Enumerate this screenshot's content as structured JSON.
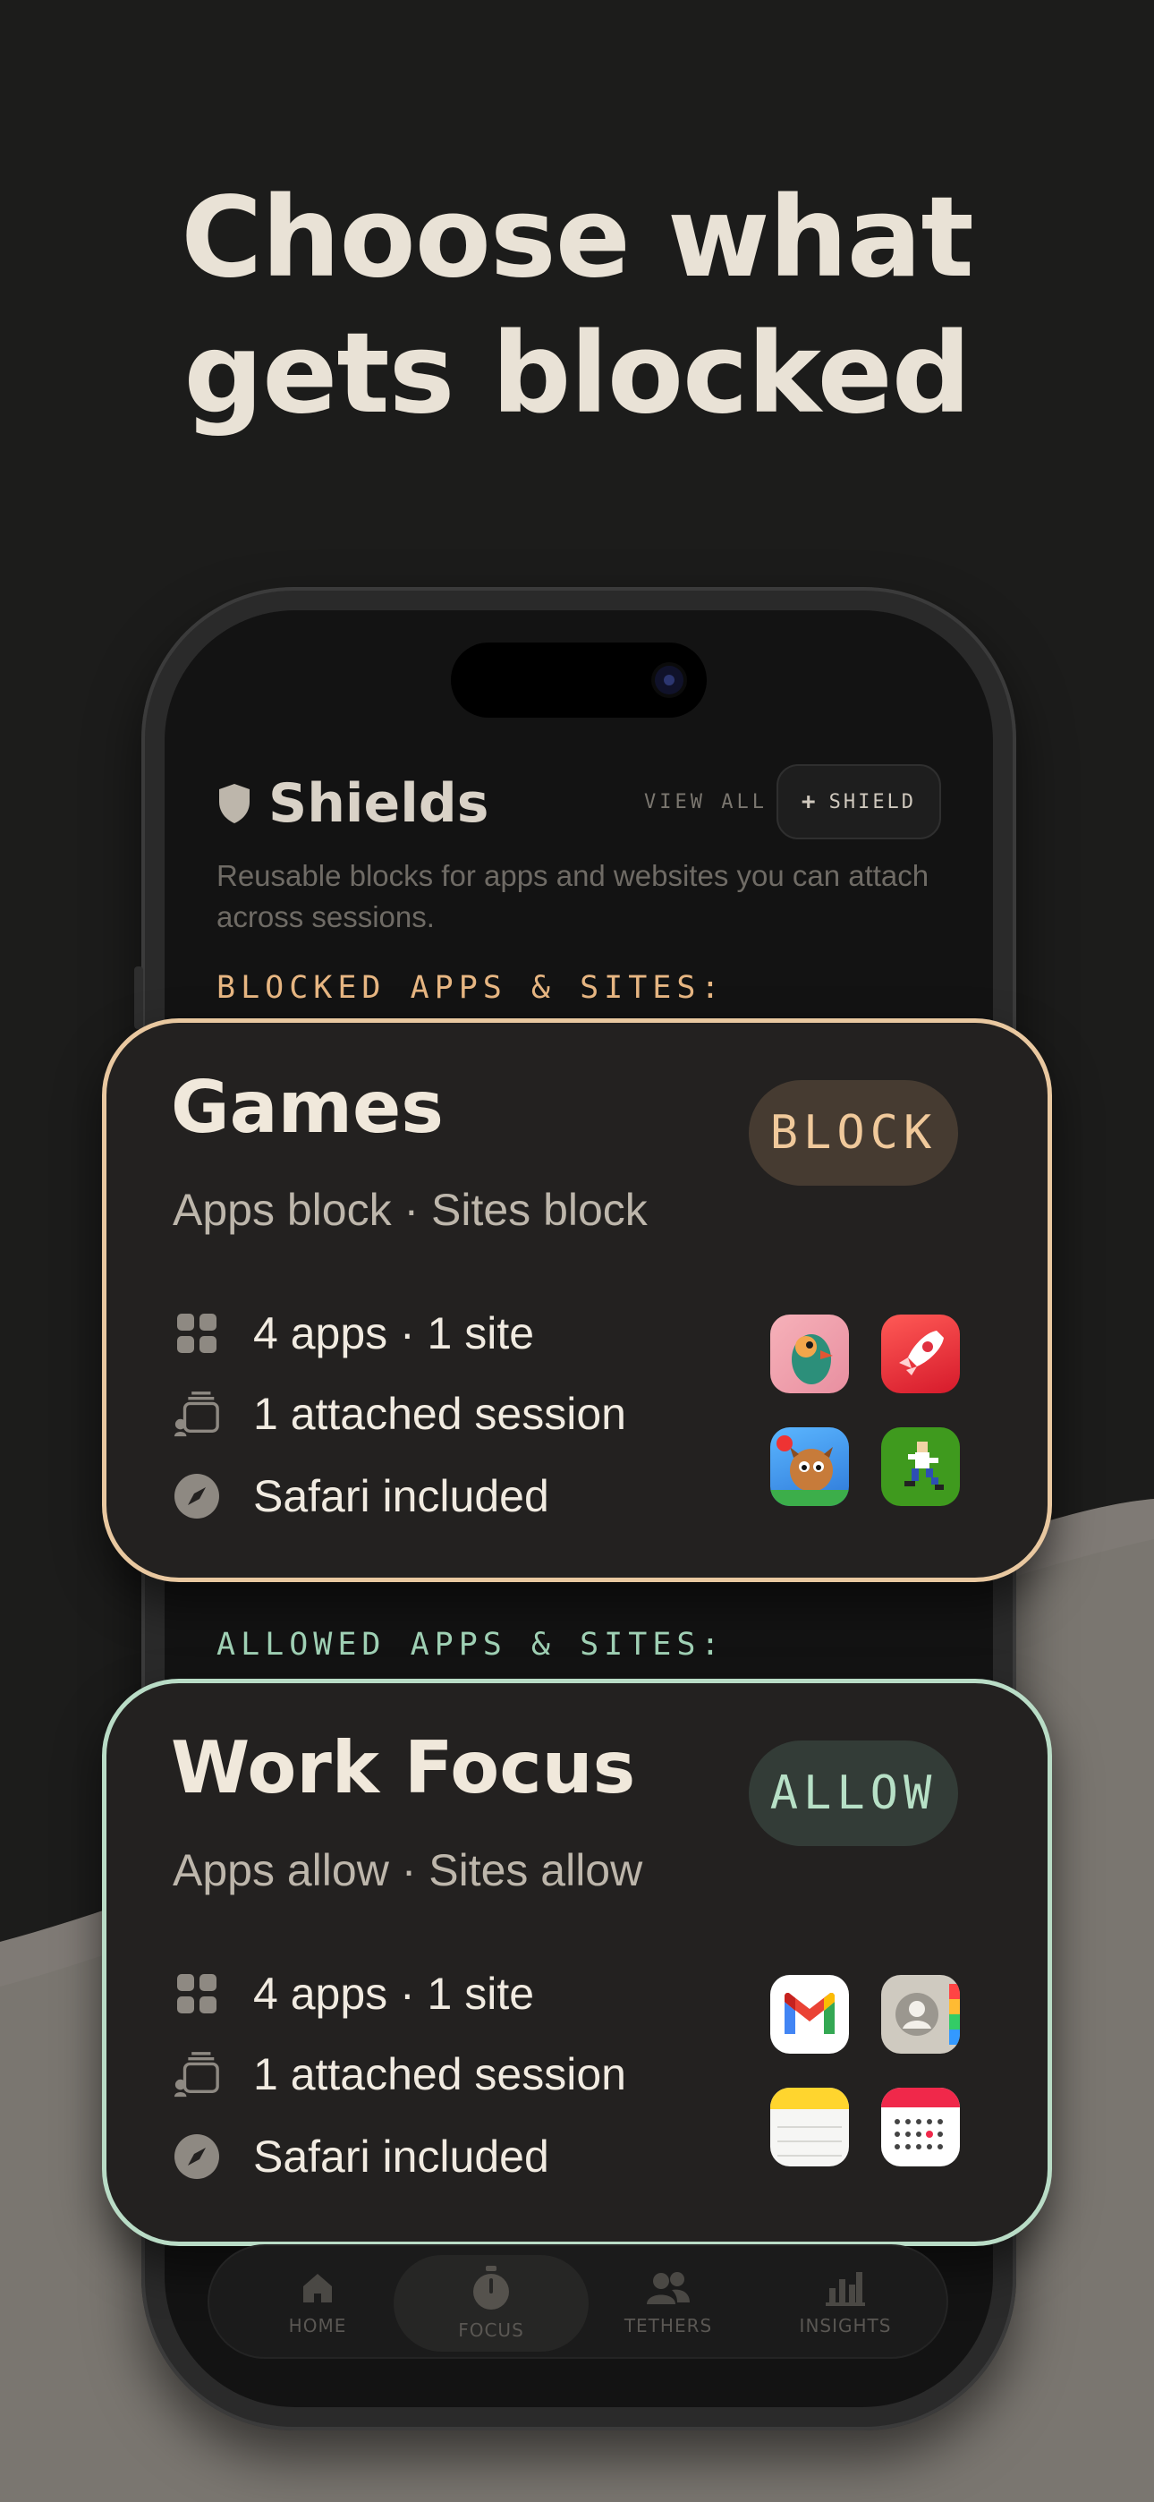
{
  "headline": {
    "line1": "Choose what",
    "line2": "gets blocked"
  },
  "shields": {
    "title": "Shields",
    "view_all": "VIEW ALL",
    "add_button_label": "SHIELD",
    "subtitle": "Reusable blocks for apps and websites you can attach across sessions."
  },
  "sections": {
    "blocked_label": "BLOCKED APPS & SITES:",
    "allowed_label": "ALLOWED APPS & SITES:"
  },
  "cards": [
    {
      "title": "Games",
      "subtitle": "Apps block · Sites block",
      "pill": "BLOCK",
      "counts": "4 apps · 1 site",
      "sessions": "1 attached session",
      "safari": "Safari included",
      "apps": [
        "game-app-icon-1",
        "rocket-game-icon",
        "tower-defense-game-icon",
        "pixel-runner-game-icon"
      ],
      "accent": "#e9c8a0"
    },
    {
      "title": "Work Focus",
      "subtitle": "Apps allow · Sites allow",
      "pill": "ALLOW",
      "counts": "4 apps · 1 site",
      "sessions": "1 attached session",
      "safari": "Safari included",
      "apps": [
        "gmail-icon",
        "contacts-icon",
        "notes-icon",
        "calendar-icon"
      ],
      "accent": "#b9dcc6"
    }
  ],
  "tabbar": {
    "tabs": [
      {
        "label": "HOME",
        "icon": "home-icon"
      },
      {
        "label": "FOCUS",
        "icon": "stopwatch-icon",
        "active": true
      },
      {
        "label": "TETHERS",
        "icon": "people-icon"
      },
      {
        "label": "INSIGHTS",
        "icon": "bar-chart-icon"
      }
    ]
  }
}
